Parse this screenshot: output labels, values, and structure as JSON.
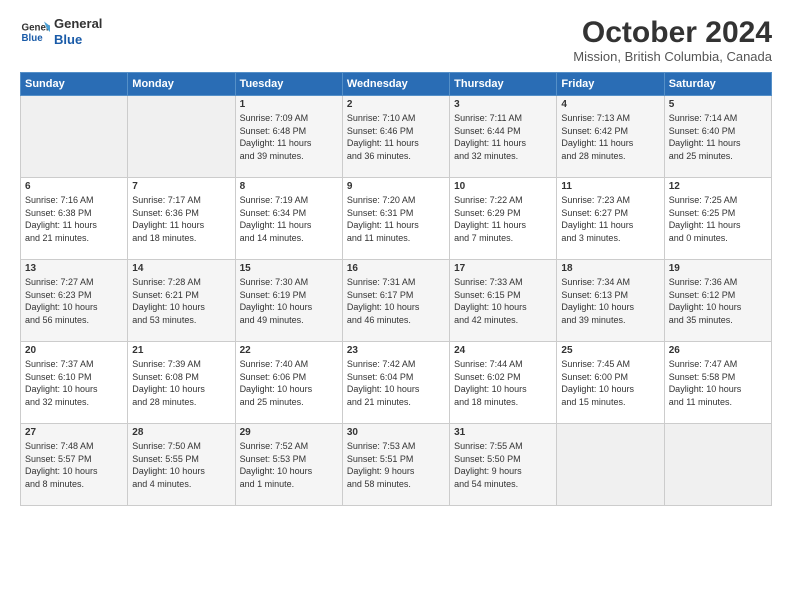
{
  "header": {
    "logo_line1": "General",
    "logo_line2": "Blue",
    "title": "October 2024",
    "location": "Mission, British Columbia, Canada"
  },
  "calendar": {
    "days_of_week": [
      "Sunday",
      "Monday",
      "Tuesday",
      "Wednesday",
      "Thursday",
      "Friday",
      "Saturday"
    ],
    "weeks": [
      [
        {
          "day": "",
          "content": ""
        },
        {
          "day": "",
          "content": ""
        },
        {
          "day": "1",
          "content": "Sunrise: 7:09 AM\nSunset: 6:48 PM\nDaylight: 11 hours\nand 39 minutes."
        },
        {
          "day": "2",
          "content": "Sunrise: 7:10 AM\nSunset: 6:46 PM\nDaylight: 11 hours\nand 36 minutes."
        },
        {
          "day": "3",
          "content": "Sunrise: 7:11 AM\nSunset: 6:44 PM\nDaylight: 11 hours\nand 32 minutes."
        },
        {
          "day": "4",
          "content": "Sunrise: 7:13 AM\nSunset: 6:42 PM\nDaylight: 11 hours\nand 28 minutes."
        },
        {
          "day": "5",
          "content": "Sunrise: 7:14 AM\nSunset: 6:40 PM\nDaylight: 11 hours\nand 25 minutes."
        }
      ],
      [
        {
          "day": "6",
          "content": "Sunrise: 7:16 AM\nSunset: 6:38 PM\nDaylight: 11 hours\nand 21 minutes."
        },
        {
          "day": "7",
          "content": "Sunrise: 7:17 AM\nSunset: 6:36 PM\nDaylight: 11 hours\nand 18 minutes."
        },
        {
          "day": "8",
          "content": "Sunrise: 7:19 AM\nSunset: 6:34 PM\nDaylight: 11 hours\nand 14 minutes."
        },
        {
          "day": "9",
          "content": "Sunrise: 7:20 AM\nSunset: 6:31 PM\nDaylight: 11 hours\nand 11 minutes."
        },
        {
          "day": "10",
          "content": "Sunrise: 7:22 AM\nSunset: 6:29 PM\nDaylight: 11 hours\nand 7 minutes."
        },
        {
          "day": "11",
          "content": "Sunrise: 7:23 AM\nSunset: 6:27 PM\nDaylight: 11 hours\nand 3 minutes."
        },
        {
          "day": "12",
          "content": "Sunrise: 7:25 AM\nSunset: 6:25 PM\nDaylight: 11 hours\nand 0 minutes."
        }
      ],
      [
        {
          "day": "13",
          "content": "Sunrise: 7:27 AM\nSunset: 6:23 PM\nDaylight: 10 hours\nand 56 minutes."
        },
        {
          "day": "14",
          "content": "Sunrise: 7:28 AM\nSunset: 6:21 PM\nDaylight: 10 hours\nand 53 minutes."
        },
        {
          "day": "15",
          "content": "Sunrise: 7:30 AM\nSunset: 6:19 PM\nDaylight: 10 hours\nand 49 minutes."
        },
        {
          "day": "16",
          "content": "Sunrise: 7:31 AM\nSunset: 6:17 PM\nDaylight: 10 hours\nand 46 minutes."
        },
        {
          "day": "17",
          "content": "Sunrise: 7:33 AM\nSunset: 6:15 PM\nDaylight: 10 hours\nand 42 minutes."
        },
        {
          "day": "18",
          "content": "Sunrise: 7:34 AM\nSunset: 6:13 PM\nDaylight: 10 hours\nand 39 minutes."
        },
        {
          "day": "19",
          "content": "Sunrise: 7:36 AM\nSunset: 6:12 PM\nDaylight: 10 hours\nand 35 minutes."
        }
      ],
      [
        {
          "day": "20",
          "content": "Sunrise: 7:37 AM\nSunset: 6:10 PM\nDaylight: 10 hours\nand 32 minutes."
        },
        {
          "day": "21",
          "content": "Sunrise: 7:39 AM\nSunset: 6:08 PM\nDaylight: 10 hours\nand 28 minutes."
        },
        {
          "day": "22",
          "content": "Sunrise: 7:40 AM\nSunset: 6:06 PM\nDaylight: 10 hours\nand 25 minutes."
        },
        {
          "day": "23",
          "content": "Sunrise: 7:42 AM\nSunset: 6:04 PM\nDaylight: 10 hours\nand 21 minutes."
        },
        {
          "day": "24",
          "content": "Sunrise: 7:44 AM\nSunset: 6:02 PM\nDaylight: 10 hours\nand 18 minutes."
        },
        {
          "day": "25",
          "content": "Sunrise: 7:45 AM\nSunset: 6:00 PM\nDaylight: 10 hours\nand 15 minutes."
        },
        {
          "day": "26",
          "content": "Sunrise: 7:47 AM\nSunset: 5:58 PM\nDaylight: 10 hours\nand 11 minutes."
        }
      ],
      [
        {
          "day": "27",
          "content": "Sunrise: 7:48 AM\nSunset: 5:57 PM\nDaylight: 10 hours\nand 8 minutes."
        },
        {
          "day": "28",
          "content": "Sunrise: 7:50 AM\nSunset: 5:55 PM\nDaylight: 10 hours\nand 4 minutes."
        },
        {
          "day": "29",
          "content": "Sunrise: 7:52 AM\nSunset: 5:53 PM\nDaylight: 10 hours\nand 1 minute."
        },
        {
          "day": "30",
          "content": "Sunrise: 7:53 AM\nSunset: 5:51 PM\nDaylight: 9 hours\nand 58 minutes."
        },
        {
          "day": "31",
          "content": "Sunrise: 7:55 AM\nSunset: 5:50 PM\nDaylight: 9 hours\nand 54 minutes."
        },
        {
          "day": "",
          "content": ""
        },
        {
          "day": "",
          "content": ""
        }
      ]
    ]
  }
}
